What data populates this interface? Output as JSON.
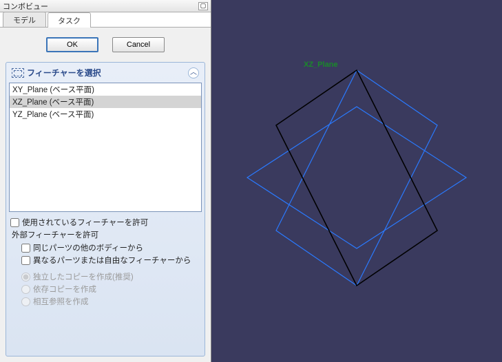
{
  "panel": {
    "title": "コンボビュー"
  },
  "tabs": {
    "model": "モデル",
    "task": "タスク"
  },
  "buttons": {
    "ok": "OK",
    "cancel": "Cancel"
  },
  "task": {
    "title": "フィーチャーを選択",
    "collapse_glyph": "︿"
  },
  "planes": {
    "items": [
      {
        "label": "XY_Plane (ベース平面)",
        "selected": false
      },
      {
        "label": "XZ_Plane (ベース平面)",
        "selected": true
      },
      {
        "label": "YZ_Plane (ベース平面)",
        "selected": false
      }
    ]
  },
  "options": {
    "allow_used": "使用されているフィーチャーを許可",
    "external_label": "外部フィーチャーを許可",
    "same_part": "同じパーツの他のボディーから",
    "diff_part": "異なるパーツまたは自由なフィーチャーから",
    "radio_independent": "独立したコピーを作成(推奨)",
    "radio_dependent": "依存コピーを作成",
    "radio_crossref": "相互参照を作成"
  },
  "viewport": {
    "selected_plane_label": "XZ_Plane"
  }
}
